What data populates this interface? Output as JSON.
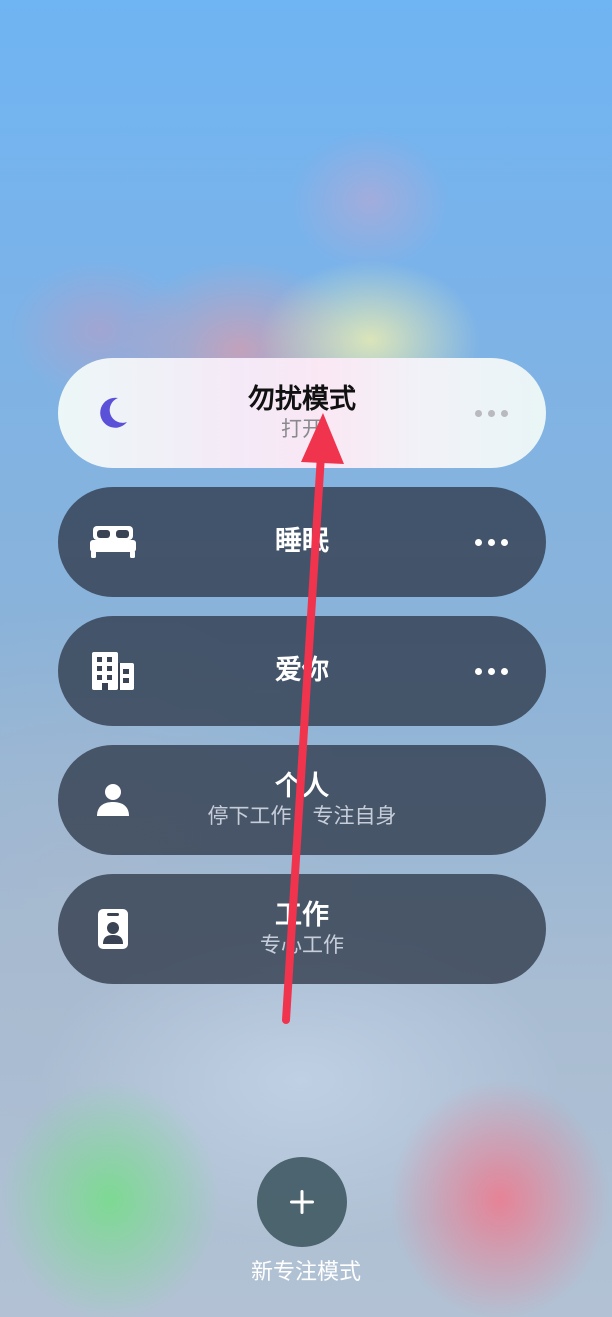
{
  "focus_modes": [
    {
      "title": "勿扰模式",
      "subtitle": "打开",
      "icon": "moon-icon",
      "active": true,
      "has_more": true,
      "icon_color": "#5b51d8"
    },
    {
      "title": "睡眠",
      "subtitle": "",
      "icon": "bed-icon",
      "active": false,
      "has_more": true
    },
    {
      "title": "爱你",
      "subtitle": "",
      "icon": "building-icon",
      "active": false,
      "has_more": true
    },
    {
      "title": "个人",
      "subtitle": "停下工作，专注自身",
      "icon": "person-icon",
      "active": false,
      "has_more": false
    },
    {
      "title": "工作",
      "subtitle": "专心工作",
      "icon": "id-badge-icon",
      "active": false,
      "has_more": false
    }
  ],
  "add_focus": {
    "label": "新专注模式",
    "icon": "plus-icon"
  },
  "annotation": {
    "type": "arrow",
    "color": "#f0344d"
  }
}
